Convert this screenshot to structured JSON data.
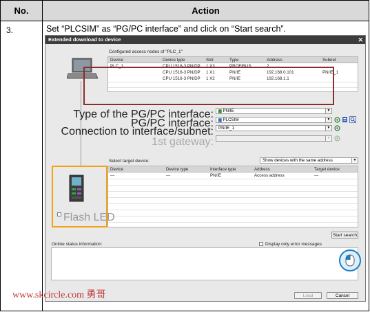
{
  "table": {
    "col_no": "No.",
    "col_action": "Action",
    "step": "3.",
    "instruction": "Set “PLCSIM” as “PG/PC interface” and click on “Start search”."
  },
  "dialog": {
    "title": "Extended download to device",
    "configured_label": "Configured access nodes of \"PLC_1\"",
    "configured_headers": [
      "Device",
      "Device type",
      "Slot",
      "Type",
      "Address",
      "Subnet"
    ],
    "configured_rows": [
      [
        "PLC_1",
        "CPU 1516-3 PN/DP",
        "1 X3",
        "PROFIBUS",
        "2",
        ""
      ],
      [
        "",
        "CPU 1516-3 PN/DP",
        "1 X1",
        "PN/IE",
        "192.168.0.101",
        "PN/IE_1"
      ],
      [
        "",
        "CPU 1516-3 PN/DP",
        "1 X2",
        "PN/IE",
        "192.168.1.1",
        ""
      ]
    ],
    "type_if_label": "Type of the PG/PC interface:",
    "type_if_value": "PN/IE",
    "pgpc_label": "PG/PC interface:",
    "pgpc_value": "PLCSIM",
    "conn_label": "Connection to interface/subnet:",
    "conn_value": "PN/IE_1",
    "gateway_label": "1st gateway:",
    "gateway_value": "",
    "target_label": "Select target device:",
    "show_value": "Show devices with the same address",
    "target_headers": [
      "Device",
      "Device type",
      "Interface type",
      "Address",
      "Target device"
    ],
    "target_rows": [
      [
        "—",
        "—",
        "PN/IE",
        "Access address",
        "—"
      ]
    ],
    "flash_led": "Flash LED",
    "start_search": "Start search",
    "online_status": "Online status information:",
    "error_only": "Display only error messages",
    "load": "Load",
    "cancel": "Cancel"
  },
  "watermark": "www.skcircle.com 勇哥",
  "colors": {
    "title_bar": "#3c3c3c",
    "red_frame": "#8b2d2d",
    "orange_frame": "#f3a018",
    "cursor": "#1d7fbf"
  }
}
